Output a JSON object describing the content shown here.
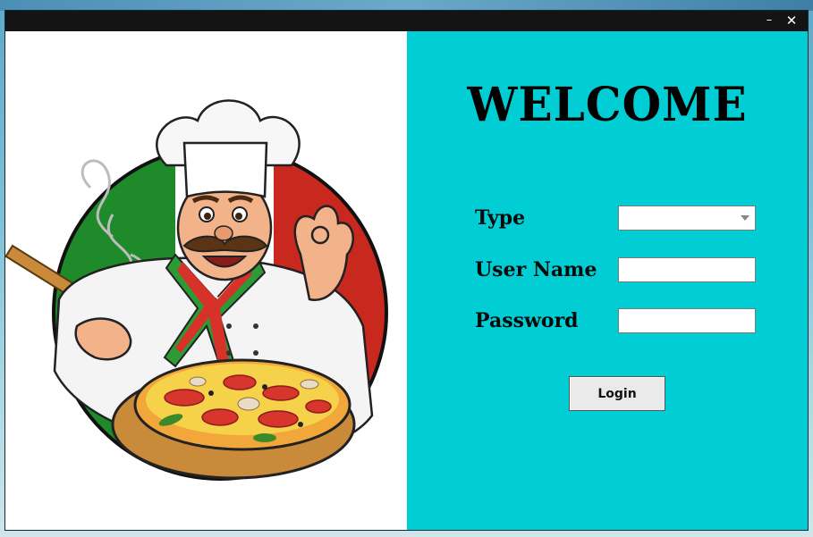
{
  "window": {
    "minimize_glyph": "–",
    "close_glyph": "✕"
  },
  "brand": {
    "illustration": "pizza-chef-illustration",
    "colors": {
      "green": "#1f8a2a",
      "red": "#c8281e",
      "panel": "#00cdd4"
    }
  },
  "form": {
    "heading": "WELCOME",
    "type_label": "Type",
    "type_value": "",
    "username_label": "User Name",
    "username_value": "",
    "password_label": "Password",
    "password_value": "",
    "login_label": "Login"
  }
}
